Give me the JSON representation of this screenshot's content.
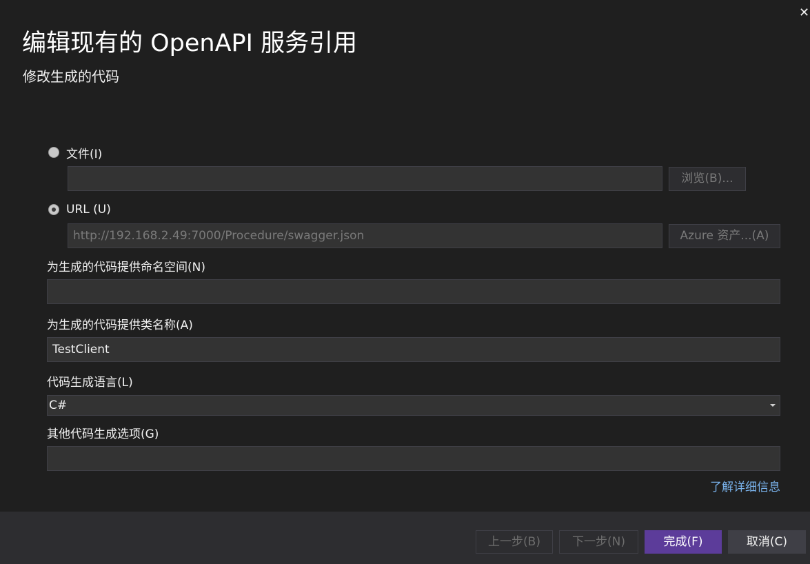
{
  "dialog": {
    "title": "编辑现有的 OpenAPI 服务引用",
    "subtitle": "修改生成的代码",
    "close_glyph": "✕"
  },
  "source": {
    "file_option_label": "文件(I)",
    "file_selected": false,
    "file_path_value": "",
    "browse_button_label": "浏览(B)...",
    "url_option_label": "URL (U)",
    "url_selected": true,
    "url_value": "http://192.168.2.49:7000/Procedure/swagger.json",
    "azure_button_label": "Azure 资产...(A)"
  },
  "fields": {
    "namespace_label": "为生成的代码提供命名空间(N)",
    "namespace_value": "",
    "classname_label": "为生成的代码提供类名称(A)",
    "classname_value": "TestClient",
    "language_label": "代码生成语言(L)",
    "language_value": "C#",
    "options_label": "其他代码生成选项(G)",
    "options_value": ""
  },
  "learn_more_link": "了解详细信息",
  "footer": {
    "previous_label": "上一步(B)",
    "next_label": "下一步(N)",
    "finish_label": "完成(F)",
    "cancel_label": "取消(C)"
  },
  "colors": {
    "background": "#1f1f1f",
    "input_background": "#333333",
    "footer_background": "#2d2d30",
    "primary_accent": "#5c3c9a",
    "link": "#7ab3ec"
  },
  "icons": {
    "close": "close-icon",
    "dropdown": "chevron-down-icon"
  }
}
